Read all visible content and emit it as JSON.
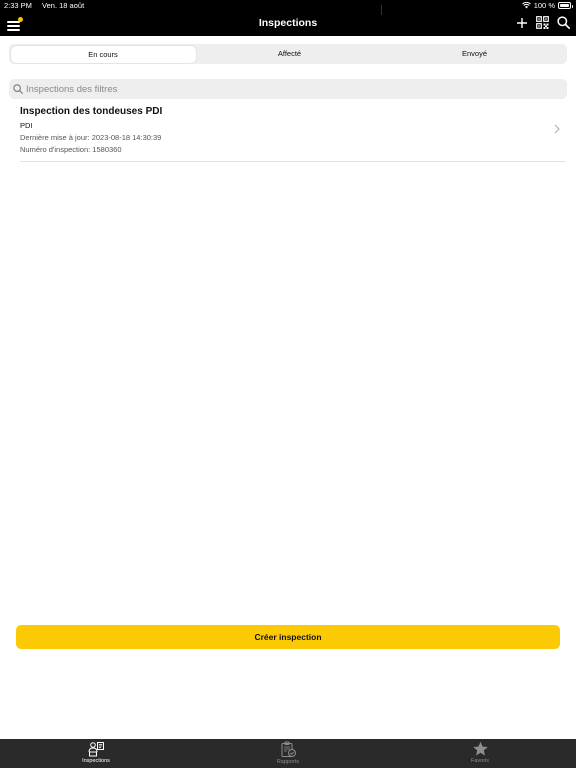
{
  "status": {
    "time": "2:33 PM",
    "date": "Ven. 18 août",
    "battery": "100 %",
    "battery_level": 1.0
  },
  "nav": {
    "title": "Inspections",
    "icons": [
      "menu-icon",
      "plus-icon",
      "qr-code-icon",
      "search-icon"
    ]
  },
  "segments": [
    {
      "label": "En cours",
      "active": true
    },
    {
      "label": "Affecté",
      "active": false
    },
    {
      "label": "Envoyé",
      "active": false
    }
  ],
  "search": {
    "placeholder": "Inspections des filtres",
    "value": ""
  },
  "inspections": [
    {
      "title": "Inspection des tondeuses PDI",
      "type": "PDI",
      "updated": "Dernière mise à jour: 2023-08-18 14:30:39",
      "number": "Numéro d'inspection: 1580360"
    }
  ],
  "create_button": {
    "label": "Créer inspection",
    "color": "#fcca04"
  },
  "tabs": [
    {
      "label": "Inspections",
      "icon": "inspections-icon",
      "active": true
    },
    {
      "label": "Rapports",
      "icon": "reports-icon",
      "active": false
    },
    {
      "label": "Favoris",
      "icon": "star-icon",
      "active": false
    }
  ]
}
